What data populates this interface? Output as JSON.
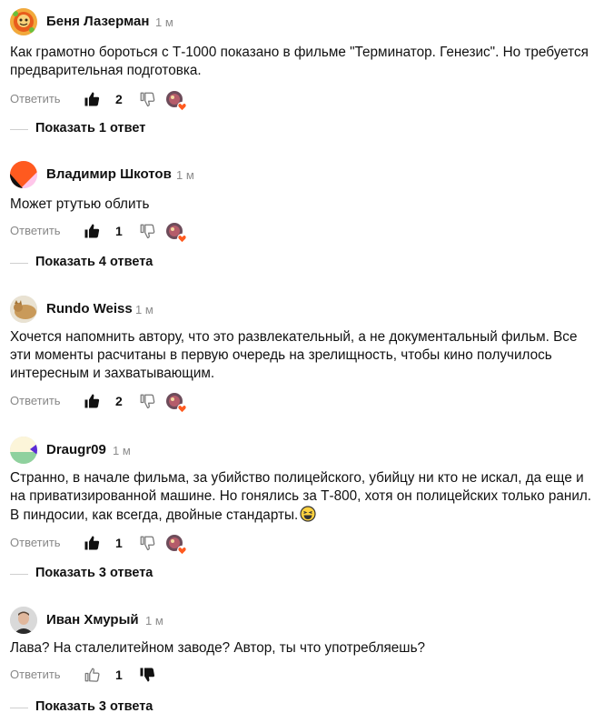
{
  "comments": [
    {
      "author": "Беня Лазерман",
      "time": "1 м",
      "text": "Как грамотно бороться с Т-1000 показано в фильме \"Терминатор. Генезис\". Но требуется предварительная подготовка.",
      "reply_label": "Ответить",
      "likes": "2",
      "avatar_icon": "avatar-orange-cartoon",
      "show_replies": "Показать 1 ответ"
    },
    {
      "author": "Владимир Шкотов",
      "time": "1 м",
      "text": "Может ртутью облить",
      "reply_label": "Ответить",
      "likes": "1",
      "avatar_icon": "avatar-orange-pink-split",
      "show_replies": "Показать 4 ответа"
    },
    {
      "author": "Rundo Weiss",
      "time": "1 м",
      "text": "Хочется напомнить автору, что это развлекательный, а не документальный фильм. Все эти моменты расчитаны в первую очередь на зрелищность, чтобы кино получилось интересным и захватывающим.",
      "reply_label": "Ответить",
      "likes": "2",
      "avatar_icon": "avatar-cat-photo",
      "show_replies": ""
    },
    {
      "author": "Draugr09",
      "time": "1 м",
      "text": "Странно, в начале фильма, за убийство полицейского, убийцу ни кто не искал, да еще и на приватизированной машине. Но гонялись за Т-800, хотя он полицейских только ранил. В пиндосии, как всегда, двойные стандарты.",
      "reply_label": "Ответить",
      "likes": "1",
      "avatar_icon": "avatar-cream-purple-green",
      "emoji_icon": "laughing-emoji-icon",
      "show_replies": "Показать 3 ответа"
    },
    {
      "author": "Иван Хмурый",
      "time": "1 м",
      "text": "Лава? На сталелитейном заводе? Автор, ты что употребляешь?",
      "reply_label": "Ответить",
      "likes": "1",
      "avatar_icon": "avatar-man-photo",
      "disliked": true,
      "show_replies": "Показать 3 ответа"
    }
  ],
  "colors": {
    "text": "#111111",
    "muted": "#888888",
    "time": "#8c8c8c",
    "divider": "#cfcfcf",
    "heart": "#ff5a1f"
  }
}
